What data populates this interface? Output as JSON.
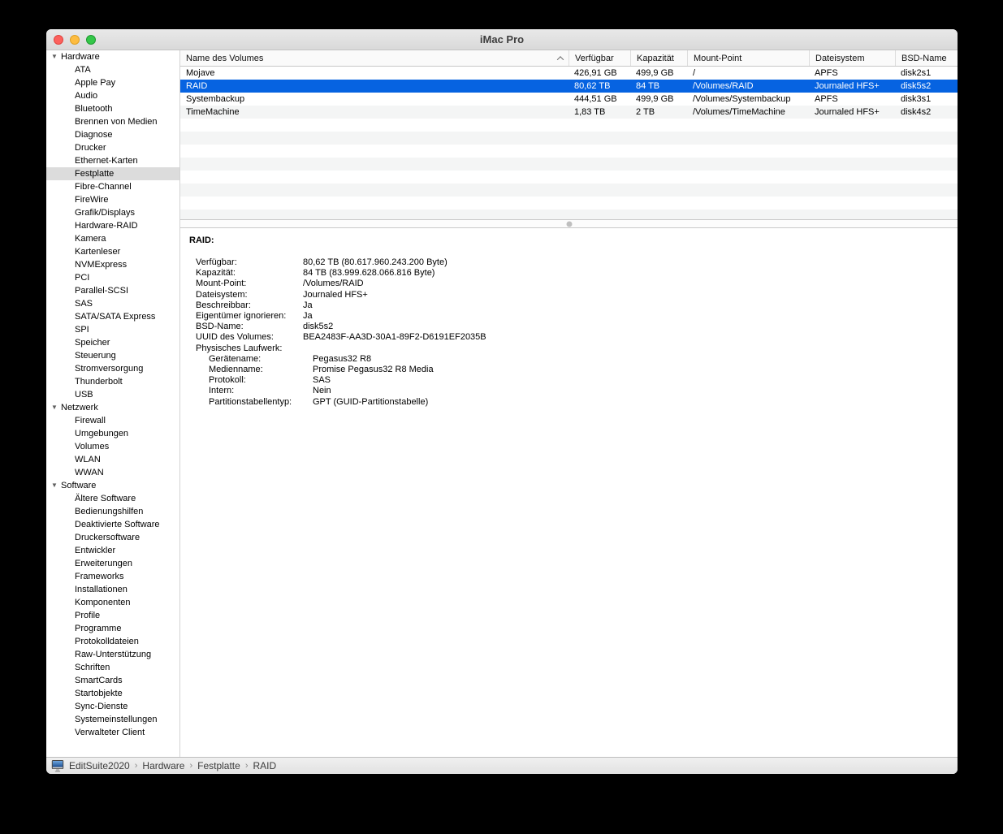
{
  "window": {
    "title": "iMac Pro"
  },
  "sidebar": {
    "disclosure_glyph": "▼",
    "selected_item": "Festplatte",
    "sections": [
      {
        "label": "Hardware",
        "items": [
          "ATA",
          "Apple Pay",
          "Audio",
          "Bluetooth",
          "Brennen von Medien",
          "Diagnose",
          "Drucker",
          "Ethernet-Karten",
          "Festplatte",
          "Fibre-Channel",
          "FireWire",
          "Grafik/Displays",
          "Hardware-RAID",
          "Kamera",
          "Kartenleser",
          "NVMExpress",
          "PCI",
          "Parallel-SCSI",
          "SAS",
          "SATA/SATA Express",
          "SPI",
          "Speicher",
          "Steuerung",
          "Stromversorgung",
          "Thunderbolt",
          "USB"
        ]
      },
      {
        "label": "Netzwerk",
        "items": [
          "Firewall",
          "Umgebungen",
          "Volumes",
          "WLAN",
          "WWAN"
        ]
      },
      {
        "label": "Software",
        "items": [
          "Ältere Software",
          "Bedienungshilfen",
          "Deaktivierte Software",
          "Druckersoftware",
          "Entwickler",
          "Erweiterungen",
          "Frameworks",
          "Installationen",
          "Komponenten",
          "Profile",
          "Programme",
          "Protokolldateien",
          "Raw-Unterstützung",
          "Schriften",
          "SmartCards",
          "Startobjekte",
          "Sync-Dienste",
          "Systemeinstellungen",
          "Verwalteter Client"
        ]
      }
    ]
  },
  "table": {
    "columns": [
      "Name des Volumes",
      "Verfügbar",
      "Kapazität",
      "Mount-Point",
      "Dateisystem",
      "BSD-Name"
    ],
    "sort_column_index": 0,
    "rows": [
      {
        "cells": [
          "Mojave",
          "426,91 GB",
          "499,9 GB",
          "/",
          "APFS",
          "disk2s1"
        ],
        "selected": false
      },
      {
        "cells": [
          "RAID",
          "80,62 TB",
          "84 TB",
          "/Volumes/RAID",
          "Journaled HFS+",
          "disk5s2"
        ],
        "selected": true
      },
      {
        "cells": [
          "Systembackup",
          "444,51 GB",
          "499,9 GB",
          "/Volumes/Systembackup",
          "APFS",
          "disk3s1"
        ],
        "selected": false
      },
      {
        "cells": [
          "TimeMachine",
          "1,83 TB",
          "2 TB",
          "/Volumes/TimeMachine",
          "Journaled HFS+",
          "disk4s2"
        ],
        "selected": false
      }
    ]
  },
  "details": {
    "heading": "RAID:",
    "fields": [
      {
        "label": "Verfügbar:",
        "value": "80,62 TB (80.617.960.243.200 Byte)",
        "indent": 0
      },
      {
        "label": "Kapazität:",
        "value": "84 TB (83.999.628.066.816 Byte)",
        "indent": 0
      },
      {
        "label": "Mount-Point:",
        "value": "/Volumes/RAID",
        "indent": 0
      },
      {
        "label": "Dateisystem:",
        "value": "Journaled HFS+",
        "indent": 0
      },
      {
        "label": "Beschreibbar:",
        "value": "Ja",
        "indent": 0
      },
      {
        "label": "Eigentümer ignorieren:",
        "value": "Ja",
        "indent": 0
      },
      {
        "label": "BSD-Name:",
        "value": "disk5s2",
        "indent": 0
      },
      {
        "label": "UUID des Volumes:",
        "value": "BEA2483F-AA3D-30A1-89F2-D6191EF2035B",
        "indent": 0
      },
      {
        "label": "Physisches Laufwerk:",
        "value": "",
        "indent": 0
      },
      {
        "label": "Gerätename:",
        "value": "Pegasus32 R8",
        "indent": 1
      },
      {
        "label": "Medienname:",
        "value": "Promise Pegasus32 R8 Media",
        "indent": 1
      },
      {
        "label": "Protokoll:",
        "value": "SAS",
        "indent": 1
      },
      {
        "label": "Intern:",
        "value": "Nein",
        "indent": 1
      },
      {
        "label": "Partitionstabellentyp:",
        "value": "GPT (GUID-Partitionstabelle)",
        "indent": 1
      }
    ]
  },
  "statusbar": {
    "separator": "›",
    "breadcrumb": [
      "EditSuite2020",
      "Hardware",
      "Festplatte",
      "RAID"
    ]
  },
  "colors": {
    "selection_blue": "#0663e1",
    "row_stripe": "#f4f5f5",
    "sidebar_selected": "#dcdcdc",
    "titlebar_top": "#e9e9e9",
    "titlebar_bottom": "#d9d9d9",
    "traffic_red": "#fc615d",
    "traffic_yellow": "#fdbc40",
    "traffic_green": "#34c749",
    "statusbar_text": "#3c3c3c"
  }
}
